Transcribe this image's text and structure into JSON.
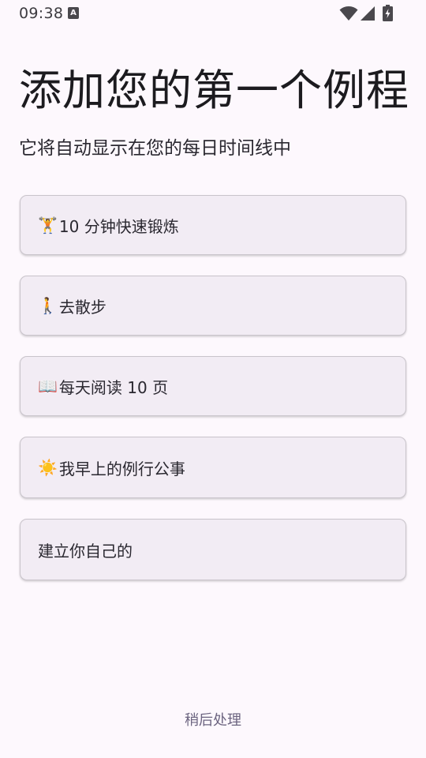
{
  "status_bar": {
    "time": "09:38",
    "notification_letter": "A",
    "icons": [
      "notification-icon",
      "wifi-icon",
      "signal-icon",
      "battery-icon"
    ]
  },
  "header": {
    "title": "添加您的第一个例程",
    "subtitle": "它将自动显示在您的每日时间线中"
  },
  "options": [
    {
      "emoji": "🏋",
      "label": "10 分钟快速锻炼"
    },
    {
      "emoji": "🚶",
      "label": "去散步"
    },
    {
      "emoji": "📖",
      "label": "每天阅读 10 页"
    },
    {
      "emoji": "☀️",
      "label": "我早上的例行公事"
    },
    {
      "emoji": "",
      "label": "建立你自己的"
    }
  ],
  "footer": {
    "later_label": "稍后处理"
  },
  "colors": {
    "background": "#fdf8fd",
    "card": "#f2ecf4",
    "card_border": "#c9c4cb",
    "text": "#1c1b1f",
    "link": "#6c6480"
  }
}
